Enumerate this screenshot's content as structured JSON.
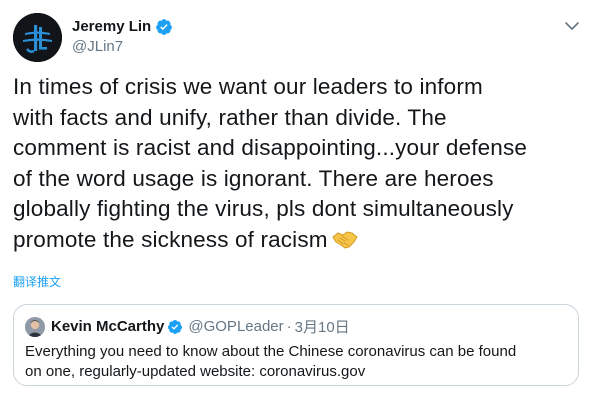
{
  "author": {
    "display_name": "Jeremy Lin",
    "handle": "@JLin7",
    "verified": true,
    "avatar_icon": "jeremy-lin-logo"
  },
  "tweet": {
    "lines": [
      "In times of crisis we want our leaders to inform",
      "with facts and unify, rather than divide. The",
      "comment is racist and disappointing...your defense",
      "of the word usage is ignorant. There are heroes",
      "globally fighting the virus, pls dont simultaneously",
      "promote the sickness of racism"
    ],
    "emoji": "handshake-emoji",
    "translate_label": "翻译推文"
  },
  "quoted_tweet": {
    "display_name": "Kevin McCarthy",
    "handle": "@GOPLeader",
    "separator": "·",
    "date": "3月10日",
    "verified": true,
    "text_lines": [
      "Everything you need to know about the Chinese coronavirus can be found",
      "on one, regularly-updated website: coronavirus.gov"
    ]
  },
  "colors": {
    "accent": "#1da1f2",
    "text": "#14171a",
    "secondary": "#657786",
    "border": "#ccd6dd"
  }
}
